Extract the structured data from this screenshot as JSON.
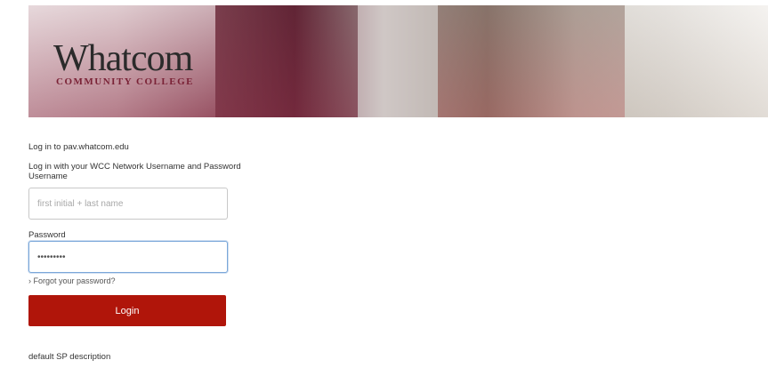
{
  "banner": {
    "logo_word": "Whatcom",
    "logo_sub": "COMMUNITY COLLEGE"
  },
  "form": {
    "heading": "Log in to pav.whatcom.edu",
    "instruction": "Log in with your WCC Network Username and Password",
    "username_label": "Username",
    "username_placeholder": "first initial + last name",
    "username_value": "",
    "password_label": "Password",
    "password_value": "•••••••••",
    "forgot_link": "› Forgot your password?",
    "login_button": "Login",
    "sp_description": "default SP description"
  },
  "colors": {
    "login_button": "#b0150a",
    "focus_border": "#7aa7d9",
    "logo_accent": "#7a2236"
  }
}
